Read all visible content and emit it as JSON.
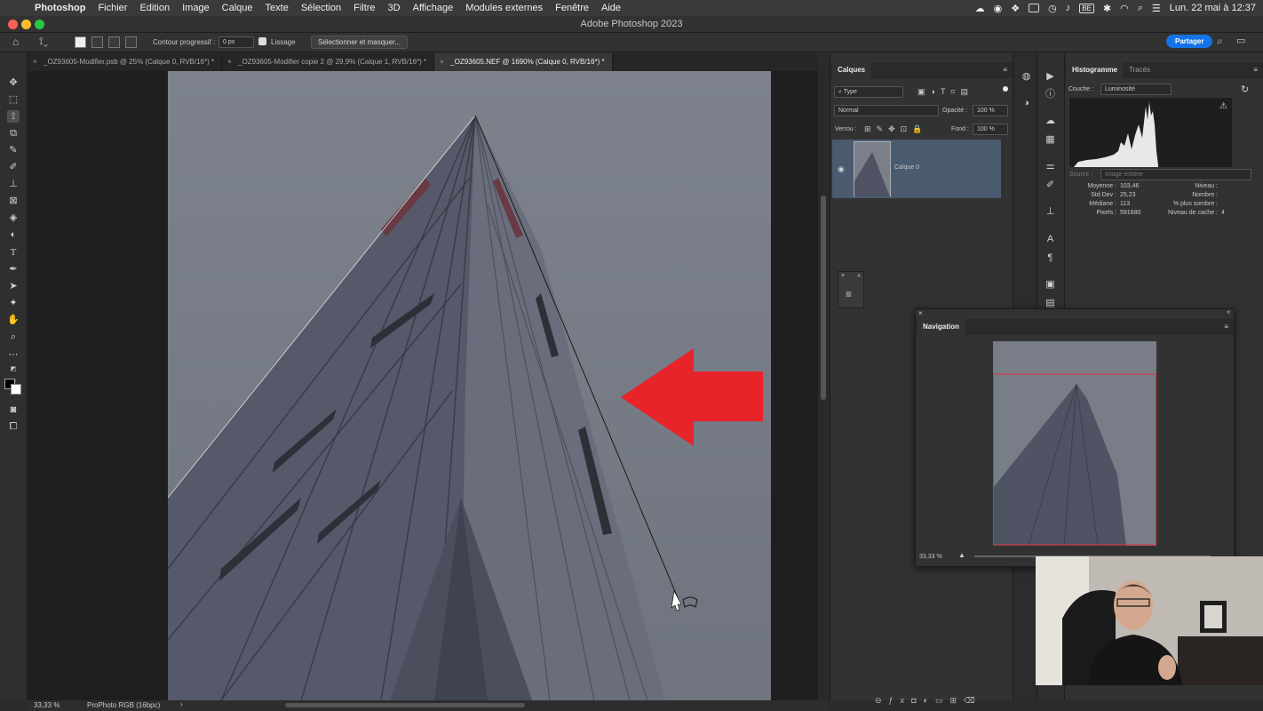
{
  "menubar": {
    "app_name": "Photoshop",
    "items": [
      "Fichier",
      "Edition",
      "Image",
      "Calque",
      "Texte",
      "Sélection",
      "Filtre",
      "3D",
      "Affichage",
      "Modules externes",
      "Fenêtre",
      "Aide"
    ],
    "input_source": "BE",
    "datetime": "Lun. 22 mai à 12:37"
  },
  "window": {
    "title": "Adobe Photoshop 2023"
  },
  "options": {
    "feather_label": "Contour progressif :",
    "feather_value": "0 px",
    "antialias_label": "Lissage",
    "select_mask_label": "Sélectionner et masquer...",
    "share_label": "Partager"
  },
  "tabs": [
    {
      "label": "_OZ93605-Modifier.psb @ 25% (Calque 0, RVB/16*) *",
      "active": false
    },
    {
      "label": "_OZ93605-Modifier copie 2 @ 29,9% (Calque 1, RVB/16*) *",
      "active": false
    },
    {
      "label": "_OZ93605.NEF @ 1690% (Calque 0, RVB/16*) *",
      "active": true
    }
  ],
  "status": {
    "zoom": "33,33 %",
    "profile": "ProPhoto RGB (16bpc)"
  },
  "layers_panel": {
    "tab_label": "Calques",
    "filter_type": "Type",
    "blend_mode": "Normal",
    "opacity_label": "Opacité :",
    "opacity_value": "100 %",
    "lock_label": "Verrou :",
    "fill_label": "Fond :",
    "fill_value": "100 %",
    "layer_name": "Calque 0"
  },
  "histogram_panel": {
    "tabs": [
      "Histogramme",
      "Tracés"
    ],
    "channel_label": "Couche :",
    "channel_value": "Luminosité",
    "source_label": "Source :",
    "source_value": "Image entière",
    "stats_left": [
      {
        "label": "Moyenne :",
        "value": "103,46"
      },
      {
        "label": "Std Dev :",
        "value": "25,23"
      },
      {
        "label": "Médiane :",
        "value": "113"
      },
      {
        "label": "Pixels :",
        "value": "591680"
      }
    ],
    "stats_right": [
      {
        "label": "Niveau :",
        "value": ""
      },
      {
        "label": "Nombre :",
        "value": ""
      },
      {
        "label": "% plus sombre :",
        "value": ""
      },
      {
        "label": "Niveau de cache :",
        "value": "4"
      }
    ]
  },
  "navigation_panel": {
    "tab_label": "Navigation",
    "zoom": "33,33 %"
  },
  "colors": {
    "accent": "#1473e6",
    "arrow": "#e8232a",
    "selection": "#4a5a6f",
    "nav_view_box": "#e03040"
  },
  "icons": [
    "apple-icon",
    "home-icon",
    "lasso-icon",
    "move-icon",
    "eye-icon",
    "search-icon",
    "lock-icon"
  ]
}
